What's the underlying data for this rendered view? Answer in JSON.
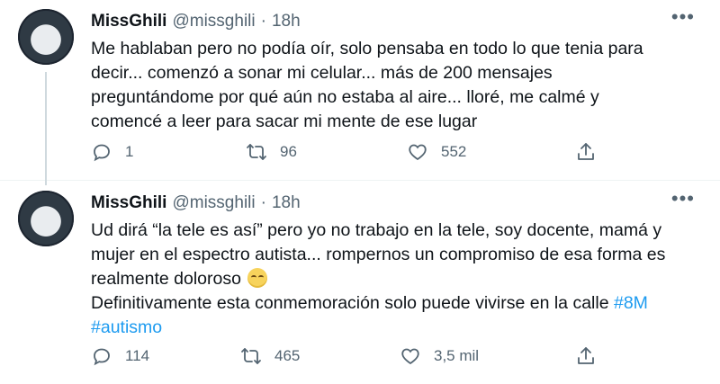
{
  "tweets": [
    {
      "display_name": "MissGhili",
      "handle": "@missghili",
      "separator": "·",
      "time": "18h",
      "more_label": "•••",
      "text": "Me hablaban pero no podía oír, solo pensaba en todo lo que tenia para\ndecir... comenzó a sonar mi celular... más de 200 mensajes\npreguntándome por qué aún no estaba al aire... lloré, me calmé y\ncomencé a leer para sacar mi mente de ese lugar",
      "replies": "1",
      "retweets": "96",
      "likes": "552"
    },
    {
      "display_name": "MissGhili",
      "handle": "@missghili",
      "separator": "·",
      "time": "18h",
      "more_label": "•••",
      "text_part1": "Ud dirá “la tele es así” pero yo no trabajo en la tele, soy docente, mamá y\nmujer en el espectro autista... rompernos un compromiso de esa forma es\nrealmente doloroso ",
      "text_part2": "\nDefinitivamente esta conmemoración solo puede vivirse en la calle ",
      "hashtag1": "#8M",
      "hashtag2": "#autismo",
      "replies": "114",
      "retweets": "465",
      "likes": "3,5 mil"
    }
  ],
  "icons": {
    "reply": "reply-icon",
    "retweet": "retweet-icon",
    "like": "heart-icon",
    "share": "share-icon",
    "more": "more-icon",
    "emoji": "relieved-face-emoji"
  },
  "colors": {
    "text": "#0f1419",
    "secondary": "#536471",
    "link": "#1d9bf0",
    "thread_line": "#cfd9de"
  }
}
